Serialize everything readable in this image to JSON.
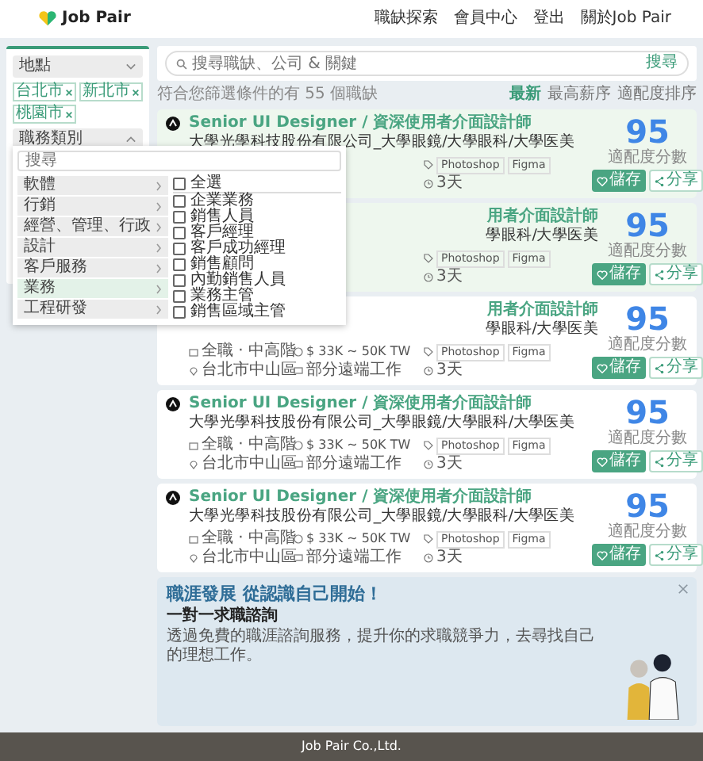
{
  "header": {
    "brand": "Job Pair",
    "nav": [
      "職缺探索",
      "會員中心",
      "登出",
      "關於Job Pair"
    ]
  },
  "sidebar": {
    "location": {
      "label": "地點",
      "expanded": false
    },
    "chips": [
      "台北市",
      "新北市",
      "桃園市"
    ],
    "category": {
      "label": "職務類別",
      "expanded": true
    }
  },
  "category_dropdown": {
    "placeholder": "搜尋",
    "groups": [
      {
        "label": "軟體",
        "selected": false
      },
      {
        "label": "行銷",
        "selected": false
      },
      {
        "label": "經營、管理、行政",
        "selected": false
      },
      {
        "label": "設計",
        "selected": false
      },
      {
        "label": "客戶服務",
        "selected": false
      },
      {
        "label": "業務",
        "selected": true
      },
      {
        "label": "工程研發",
        "selected": false
      }
    ],
    "options": [
      {
        "label": "全選",
        "checked": false
      },
      {
        "label": "企業業務",
        "checked": false
      },
      {
        "label": "銷售人員",
        "checked": false
      },
      {
        "label": "客戶經理",
        "checked": false
      },
      {
        "label": "客戶成功經理",
        "checked": false
      },
      {
        "label": "銷售顧問",
        "checked": false
      },
      {
        "label": "內勤銷售人員",
        "checked": false
      },
      {
        "label": "業務主管",
        "checked": false
      },
      {
        "label": "銷售區域主管",
        "checked": false
      }
    ]
  },
  "search": {
    "placeholder": "搜尋職缺、公司 & 關鍵",
    "button": "搜尋"
  },
  "results": {
    "summary": "符合您篩選條件的有 55 個職缺",
    "sort": [
      {
        "label": "最新",
        "selected": true
      },
      {
        "label": "最高薪序",
        "selected": false
      },
      {
        "label": "適配度排序",
        "selected": false
      }
    ]
  },
  "jobs": [
    {
      "highlighted": true,
      "title": "Senior UI Designer / 資深使用者介面設計師",
      "title_cut": false,
      "company": "大學光學科技股份有限公司_大學眼鏡/大學眼科/大學医美",
      "company_cut": false,
      "skills": [
        "Photoshop",
        "Figma"
      ],
      "days": "3天",
      "score": "95",
      "score_label": "適配度分數",
      "save": "儲存",
      "share": "分享"
    },
    {
      "highlighted": true,
      "title": "用者介面設計師",
      "title_cut": true,
      "company": "學眼科/大學医美",
      "company_cut": true,
      "skills": [
        "Photoshop",
        "Figma"
      ],
      "days": "3天",
      "score": "95",
      "score_label": "適配度分數",
      "save": "儲存",
      "share": "分享"
    },
    {
      "highlighted": false,
      "title": "用者介面設計師",
      "title_cut": true,
      "company": "學眼科/大學医美",
      "company_cut": true,
      "level": "全職 · 中高階",
      "salary": "$ 33K ~ 50K TW",
      "skills": [
        "Photoshop",
        "Figma"
      ],
      "location": "台北市中山區",
      "remote": "部分遠端工作",
      "days": "3天",
      "score": "95",
      "score_label": "適配度分數",
      "save": "儲存",
      "share": "分享"
    },
    {
      "highlighted": false,
      "title": "Senior UI Designer / 資深使用者介面設計師",
      "title_cut": false,
      "company": "大學光學科技股份有限公司_大學眼鏡/大學眼科/大學医美",
      "company_cut": false,
      "level": "全職 · 中高階",
      "salary": "$ 33K ~ 50K TW",
      "skills": [
        "Photoshop",
        "Figma"
      ],
      "location": "台北市中山區",
      "remote": "部分遠端工作",
      "days": "3天",
      "score": "95",
      "score_label": "適配度分數",
      "save": "儲存",
      "share": "分享"
    },
    {
      "highlighted": false,
      "title": "Senior UI Designer / 資深使用者介面設計師",
      "title_cut": false,
      "company": "大學光學科技股份有限公司_大學眼鏡/大學眼科/大學医美",
      "company_cut": false,
      "level": "全職 · 中高階",
      "salary": "$ 33K ~ 50K TW",
      "skills": [
        "Photoshop",
        "Figma"
      ],
      "location": "台北市中山區",
      "remote": "部分遠端工作",
      "days": "3天",
      "score": "95",
      "score_label": "適配度分數",
      "save": "儲存",
      "share": "分享"
    }
  ],
  "banner": {
    "title": "職涯發展 從認識自己開始！",
    "subtitle": "一對一求職諮詢",
    "text": "透過免費的職涯諮詢服務，提升你的求職競爭力，去尋找自己的理想工作。"
  },
  "footer": "Job Pair Co.,Ltd."
}
